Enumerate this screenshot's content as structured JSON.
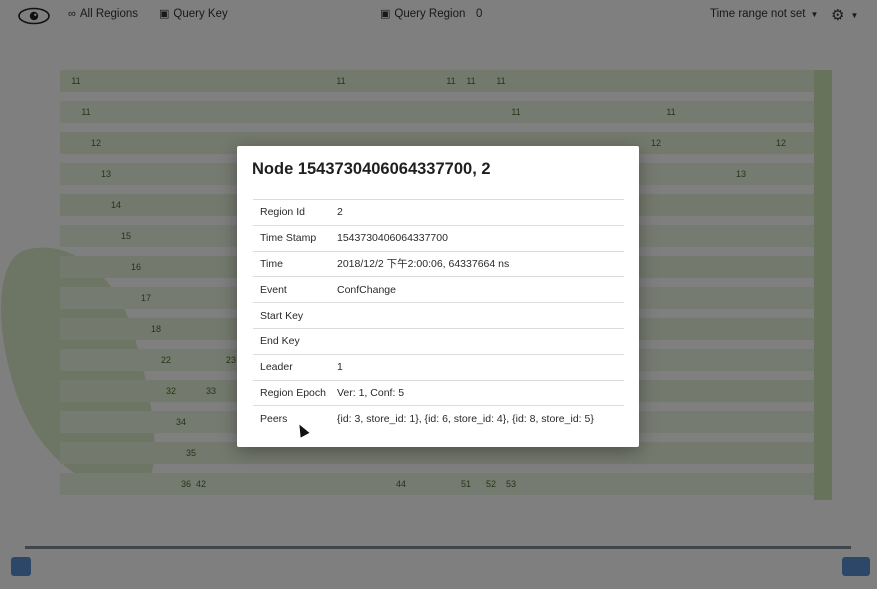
{
  "navbar": {
    "all_regions_label": "All Regions",
    "query_key_label": "Query Key",
    "query_region_label": "Query Region",
    "region_count": "0",
    "time_range_label": "Time range not set"
  },
  "background": {
    "cells": [
      "11",
      "11",
      "11",
      "11",
      "11",
      "11",
      "11",
      "11",
      "12",
      "12",
      "12",
      "13",
      "13",
      "14",
      "15",
      "16",
      "17",
      "18",
      "22",
      "23",
      "32",
      "33",
      "34",
      "35",
      "36",
      "42",
      "44",
      "51",
      "52",
      "53"
    ]
  },
  "modal": {
    "title": "Node 1543730406064337700, 2",
    "rows": [
      {
        "key": "Region Id",
        "value": "2"
      },
      {
        "key": "Time Stamp",
        "value": "1543730406064337700"
      },
      {
        "key": "Time",
        "value": "2018/12/2 下午2:00:06, 64337664 ns"
      },
      {
        "key": "Event",
        "value": "ConfChange"
      },
      {
        "key": "Start Key",
        "value": ""
      },
      {
        "key": "End Key",
        "value": ""
      },
      {
        "key": "Leader",
        "value": "1"
      },
      {
        "key": "Region Epoch",
        "value": "Ver: 1, Conf: 5"
      },
      {
        "key": "Peers",
        "value": "{id: 3, store_id: 1}, {id: 6, store_id: 4}, {id: 8, store_id: 5}"
      }
    ]
  },
  "colors": {
    "overlay": "rgba(0,0,0,0.5)",
    "accent": "#5b8fd0",
    "heat_base": "#e8f3da"
  }
}
